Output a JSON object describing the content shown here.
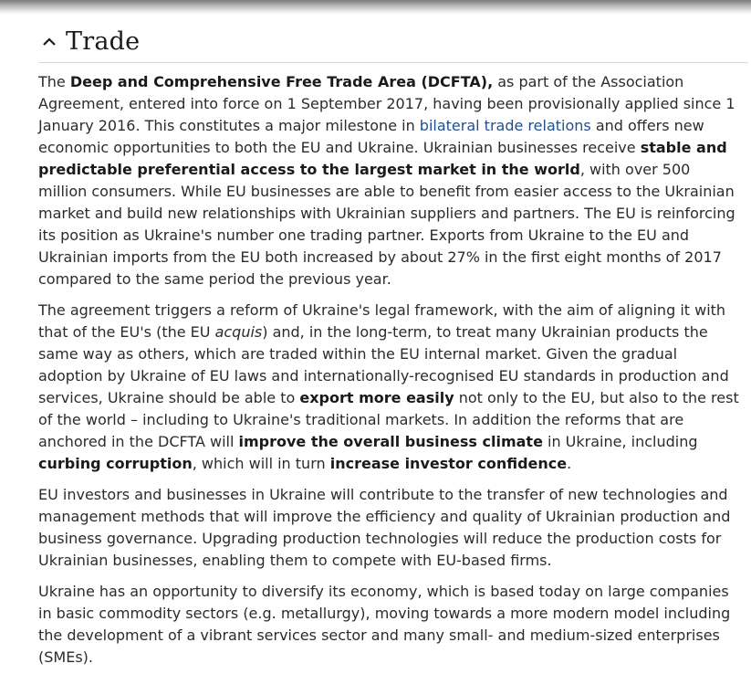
{
  "section": {
    "title": "Trade",
    "toggle_icon": "chevron-up-icon"
  },
  "paragraph1": {
    "s1": "The ",
    "b1": "Deep and Comprehensive Free Trade Area (DCFTA),",
    "s2": " as part of the Association Agreement, entered into force on 1 September 2017, having been provisionally applied since 1 January 2016. This constitutes a major milestone in ",
    "link": "bilateral trade relations",
    "s3": " and offers new economic opportunities to both the EU and Ukraine. Ukrainian businesses receive ",
    "b2": "stable and predictable preferential access to the largest market in the world",
    "s4": ", with over 500 million consumers. While EU businesses are able to benefit from easier access to the Ukrainian market and build new relationships with Ukrainian suppliers and partners. The EU is reinforcing its position as Ukraine's number one trading partner. Exports from Ukraine to the EU and Ukrainian imports from the EU both increased by about 27% in the first eight months of 2017 compared to the same period the previous year."
  },
  "paragraph2": {
    "s1": "The agreement triggers a reform of Ukraine's legal framework, with the aim of aligning it with that of the EU's (the EU ",
    "i1": "acquis",
    "s2": ") and, in the long-term, to treat many Ukrainian products the same way as others, which are traded within the EU internal market. Given the gradual adoption by Ukraine of EU laws and internationally-recognised EU standards in production and services, Ukraine should be able to ",
    "b1": "export more easily",
    "s3": " not only to the EU, but also to the rest of the world – including to Ukraine's traditional markets. In addition the reforms that are anchored in the DCFTA will ",
    "b2": "improve the overall business climate",
    "s4": " in Ukraine, including ",
    "b3": "curbing corruption",
    "s5": ", which will in turn ",
    "b4": "increase investor confidence",
    "s6": "."
  },
  "paragraph3": {
    "text": "EU investors and businesses in Ukraine will contribute to the transfer of new technologies and management methods that will improve the efficiency and quality of Ukrainian production and business governance.  Upgrading production technologies will reduce the production costs for Ukrainian businesses, enabling them to compete with EU-based firms."
  },
  "paragraph4": {
    "text": "Ukraine has an opportunity to diversify its economy, which is based today on large companies in basic commodity sectors (e.g. metallurgy), moving towards a more modern model including the development of a vibrant services sector and many small- and medium-sized enterprises (SMEs)."
  },
  "colors": {
    "text": "#2b2b2b",
    "link": "#1f4f8f",
    "divider": "#d8d8d8"
  }
}
